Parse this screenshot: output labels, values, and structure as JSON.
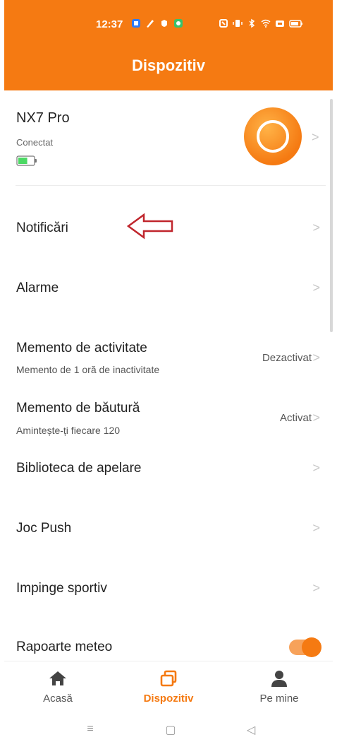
{
  "status_bar": {
    "time": "12:37",
    "left_icons": [
      "app-icon-blue",
      "paint-icon",
      "shield-icon",
      "green-app-icon"
    ],
    "right_icons": [
      "nfc-icon",
      "vibrate-icon",
      "bluetooth-icon",
      "wifi-icon",
      "signal-icon",
      "battery-icon"
    ]
  },
  "header": {
    "title": "Dispozitiv",
    "color": "#f57a12"
  },
  "device": {
    "name": "NX7 Pro",
    "status": "Conectat",
    "battery_level": 0.6,
    "battery_color": "#4cd964"
  },
  "menu": [
    {
      "title": "Notificări"
    },
    {
      "title": "Alarme"
    },
    {
      "title": "Memento de activitate",
      "subtitle": "Memento de 1 oră de inactivitate",
      "value": "Dezactivat"
    },
    {
      "title": "Memento de băutură",
      "subtitle": "Amintește-ți fiecare 120",
      "value": "Activat"
    },
    {
      "title": "Biblioteca de apelare"
    },
    {
      "title": "Joc Push"
    },
    {
      "title": "Impinge sportiv"
    },
    {
      "title": "Rapoarte meteo",
      "toggle": true
    }
  ],
  "annotation": {
    "arrow_color": "#c0262d"
  },
  "tabs": [
    {
      "label": "Acasă",
      "icon": "home-icon"
    },
    {
      "label": "Dispozitiv",
      "icon": "device-icon",
      "active": true
    },
    {
      "label": "Pe mine",
      "icon": "user-icon"
    }
  ],
  "nav": {
    "menu_icon": "≡",
    "home_icon": "▢",
    "back_icon": "◁"
  }
}
